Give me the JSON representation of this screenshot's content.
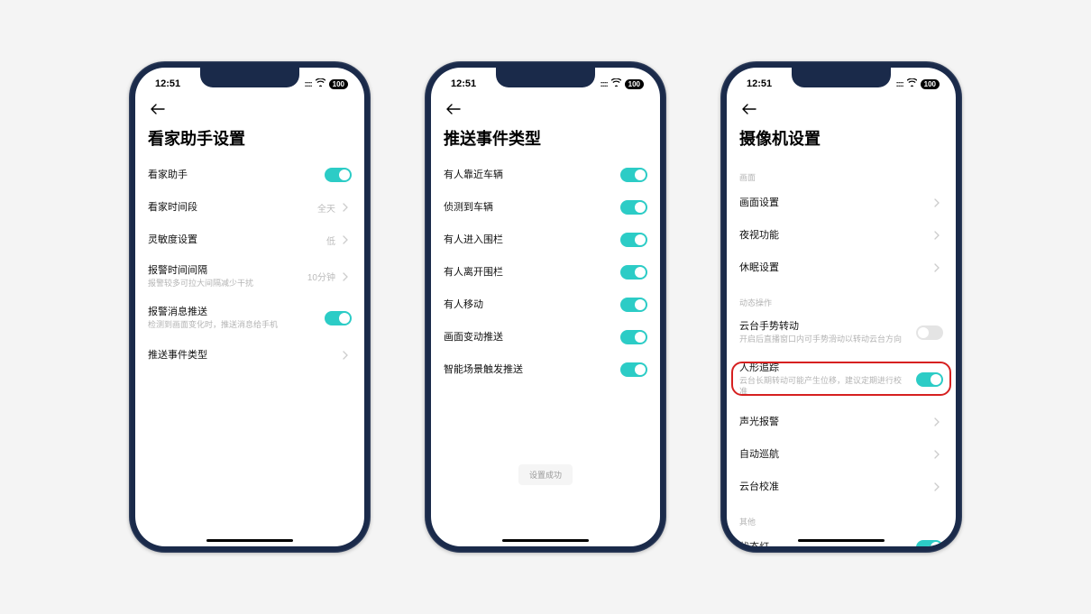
{
  "status": {
    "time": "12:51",
    "battery": "100"
  },
  "phone1": {
    "title": "看家助手设置",
    "rows": [
      {
        "label": "看家助手",
        "type": "toggle",
        "on": true
      },
      {
        "label": "看家时间段",
        "type": "nav",
        "value": "全天"
      },
      {
        "label": "灵敏度设置",
        "type": "nav",
        "value": "低"
      },
      {
        "label": "报警时间间隔",
        "sub": "报警较多可拉大间隔减少干扰",
        "type": "nav",
        "value": "10分钟"
      },
      {
        "label": "报警消息推送",
        "sub": "检测到画面变化时，推送消息给手机",
        "type": "toggle",
        "on": true
      },
      {
        "label": "推送事件类型",
        "type": "nav"
      }
    ]
  },
  "phone2": {
    "title": "推送事件类型",
    "rows": [
      {
        "label": "有人靠近车辆",
        "on": true
      },
      {
        "label": "侦测到车辆",
        "on": true
      },
      {
        "label": "有人进入围栏",
        "on": true
      },
      {
        "label": "有人离开围栏",
        "on": true
      },
      {
        "label": "有人移动",
        "on": true
      },
      {
        "label": "画面变动推送",
        "on": true
      },
      {
        "label": "智能场景触发推送",
        "on": true
      }
    ],
    "toast": "设置成功"
  },
  "phone3": {
    "title": "摄像机设置",
    "section1": "画面",
    "rows1": [
      {
        "label": "画面设置",
        "type": "nav"
      },
      {
        "label": "夜视功能",
        "type": "nav"
      },
      {
        "label": "休眠设置",
        "type": "nav"
      }
    ],
    "section2": "动态操作",
    "rows2": [
      {
        "label": "云台手势转动",
        "sub": "开启后直播窗口内可手势滑动以转动云台方向",
        "type": "toggle",
        "on": false
      },
      {
        "label": "人形追踪",
        "sub": "云台长期转动可能产生位移，建议定期进行校准",
        "type": "toggle",
        "on": true
      },
      {
        "label": "声光报警",
        "type": "nav"
      },
      {
        "label": "自动巡航",
        "type": "nav"
      },
      {
        "label": "云台校准",
        "type": "nav"
      }
    ],
    "section3": "其他",
    "rows3": [
      {
        "label": "状态灯",
        "type": "toggle",
        "on": true
      }
    ]
  }
}
